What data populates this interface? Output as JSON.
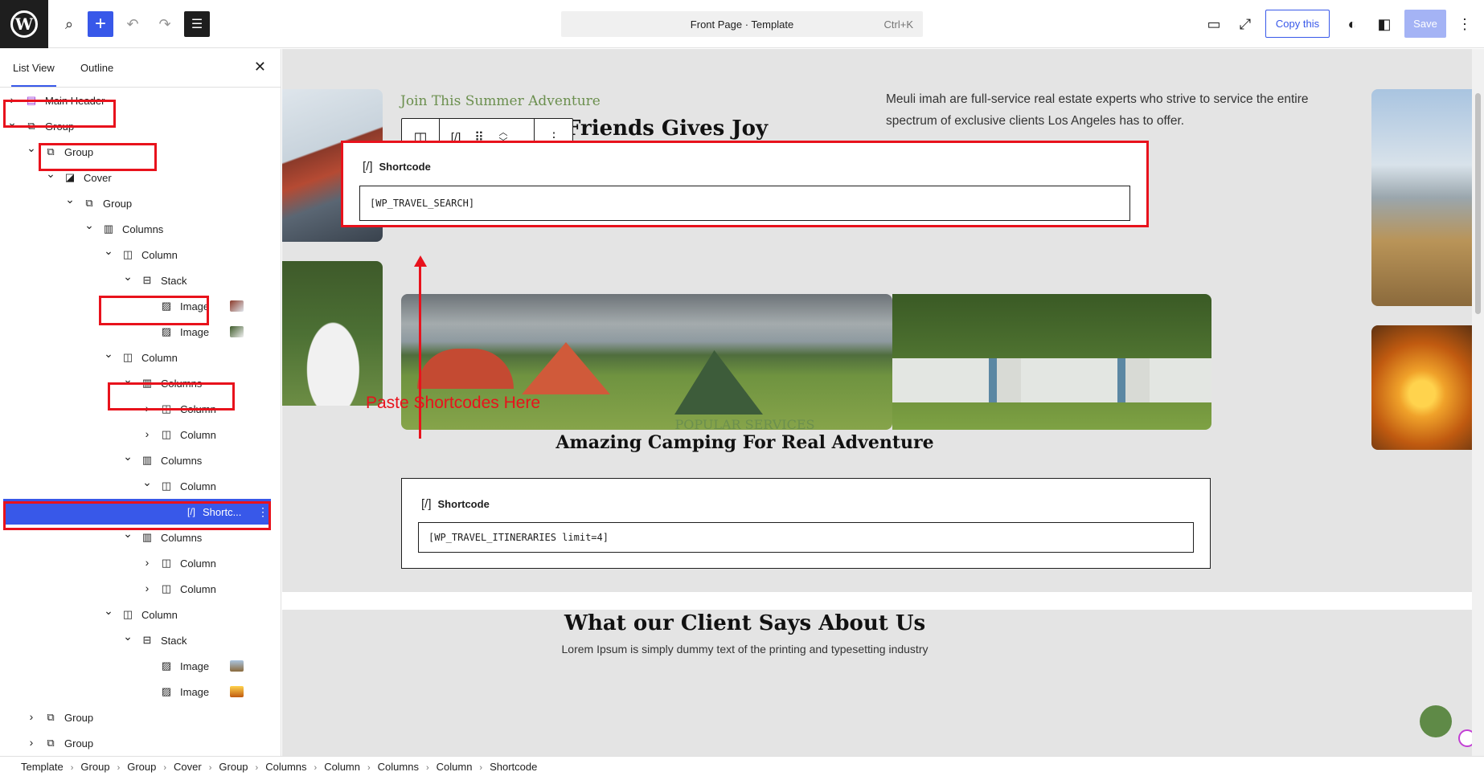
{
  "header": {
    "title": "Front Page · Template",
    "shortcut": "Ctrl+K",
    "copy_label": "Copy this",
    "save_label": "Save"
  },
  "sidebar": {
    "tabs": [
      "List View",
      "Outline"
    ],
    "rows": [
      {
        "label": "Main Header",
        "icon": "template-part-icon",
        "chev": "›"
      },
      {
        "label": "Group",
        "icon": "group-icon",
        "chev": "⌄"
      },
      {
        "label": "Group",
        "icon": "group-icon",
        "chev": "⌄"
      },
      {
        "label": "Cover",
        "icon": "cover-icon",
        "chev": "⌄"
      },
      {
        "label": "Group",
        "icon": "group-icon",
        "chev": "⌄"
      },
      {
        "label": "Columns",
        "icon": "columns-icon",
        "chev": "⌄"
      },
      {
        "label": "Column",
        "icon": "column-icon",
        "chev": "⌄"
      },
      {
        "label": "Stack",
        "icon": "stack-icon",
        "chev": "⌄"
      },
      {
        "label": "Image",
        "icon": "image-icon",
        "chev": ""
      },
      {
        "label": "Image",
        "icon": "image-icon",
        "chev": ""
      },
      {
        "label": "Column",
        "icon": "column-icon",
        "chev": "⌄"
      },
      {
        "label": "Columns",
        "icon": "columns-icon",
        "chev": "⌄"
      },
      {
        "label": "Column",
        "icon": "column-icon",
        "chev": "›"
      },
      {
        "label": "Column",
        "icon": "column-icon",
        "chev": "›"
      },
      {
        "label": "Columns",
        "icon": "columns-icon",
        "chev": "⌄"
      },
      {
        "label": "Column",
        "icon": "column-icon",
        "chev": "⌄"
      },
      {
        "label": "Shortc...",
        "icon": "shortcode-icon",
        "chev": ""
      },
      {
        "label": "Columns",
        "icon": "columns-icon",
        "chev": "⌄"
      },
      {
        "label": "Column",
        "icon": "column-icon",
        "chev": "›"
      },
      {
        "label": "Column",
        "icon": "column-icon",
        "chev": "›"
      },
      {
        "label": "Column",
        "icon": "column-icon",
        "chev": "⌄"
      },
      {
        "label": "Stack",
        "icon": "stack-icon",
        "chev": "⌄"
      },
      {
        "label": "Image",
        "icon": "image-icon",
        "chev": ""
      },
      {
        "label": "Image",
        "icon": "image-icon",
        "chev": ""
      },
      {
        "label": "Group",
        "icon": "group-icon",
        "chev": "›"
      },
      {
        "label": "Group",
        "icon": "group-icon",
        "chev": "›"
      }
    ]
  },
  "canvas": {
    "eyebrow": "Join This Summer Adventure",
    "heading": "Friends Gives Joy",
    "heading_prefix": "h",
    "intro": "Meuli imah are full-service real estate experts who strive to service the entire spectrum of exclusive clients Los Angeles has to offer.",
    "shortcode_label": "Shortcode",
    "shortcode_1": "[WP_TRAVEL_SEARCH]",
    "annotation": "Paste Shortcodes Here",
    "services_eyebrow": "POPULAR SERVICES",
    "services_heading": "Amazing Camping For Real Adventure",
    "shortcode_2": "[WP_TRAVEL_ITINERARIES limit=4]",
    "testimonials_heading": "What our Client Says About Us",
    "testimonials_sub": "Lorem Ipsum is simply dummy text of the printing and typesetting industry"
  },
  "breadcrumb": [
    "Template",
    "Group",
    "Group",
    "Cover",
    "Group",
    "Columns",
    "Column",
    "Columns",
    "Column",
    "Shortcode"
  ],
  "colors": {
    "accent": "#3858e9",
    "annotation": "#e8121c",
    "brand_green": "#6b8f4e"
  }
}
